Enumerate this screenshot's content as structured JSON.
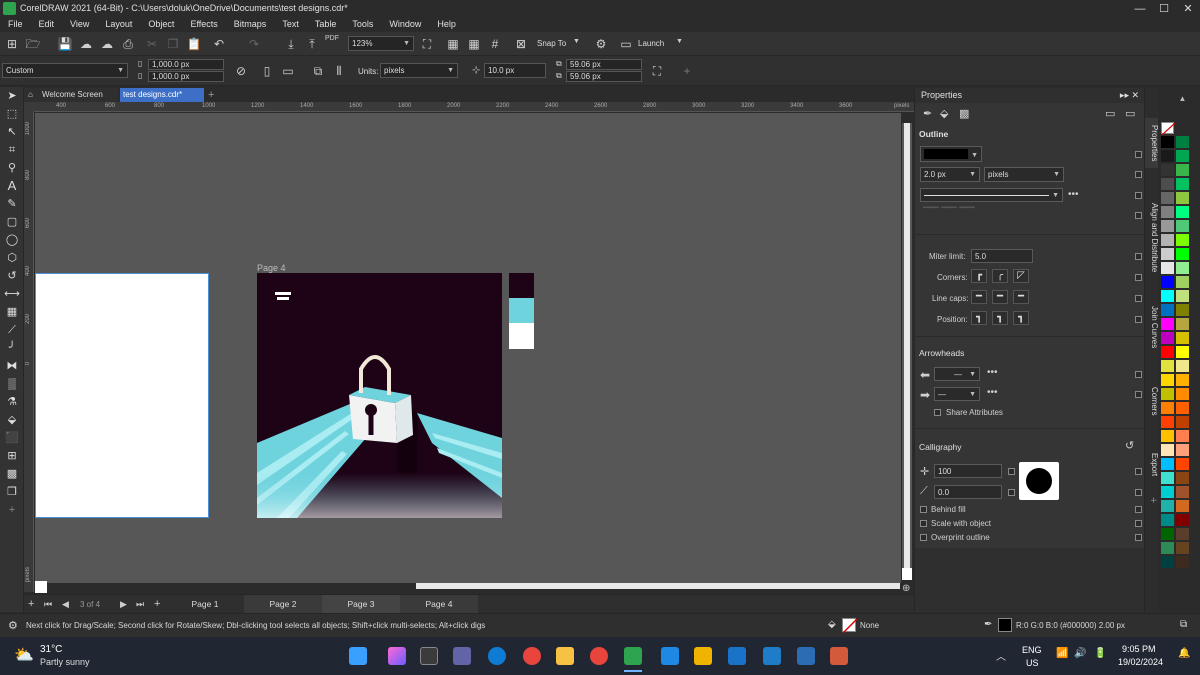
{
  "app": {
    "title": "CorelDRAW 2021 (64-Bit) - C:\\Users\\doluk\\OneDrive\\Documents\\test designs.cdr*"
  },
  "window_controls": {
    "minimize": "—",
    "maximize": "☐",
    "close": "✕"
  },
  "menu": [
    "File",
    "Edit",
    "View",
    "Layout",
    "Object",
    "Effects",
    "Bitmaps",
    "Text",
    "Table",
    "Tools",
    "Window",
    "Help"
  ],
  "toolbar": {
    "pdf_label": "PDF",
    "zoom_value": "123%",
    "snap_to": "Snap To",
    "launch": "Launch"
  },
  "property_bar": {
    "page_preset": "Custom",
    "width": "1,000.0 px",
    "height": "1,000.0 px",
    "units_label": "Units:",
    "units_value": "pixels",
    "nudge": "10.0 px",
    "dup_x": "59.06 px",
    "dup_y": "59.06 px"
  },
  "doc_tabs": [
    {
      "label": "Welcome Screen",
      "active": false
    },
    {
      "label": "test designs.cdr*",
      "active": true
    }
  ],
  "ruler": {
    "h_ticks": [
      "400",
      "600",
      "800",
      "1000",
      "1200",
      "1400",
      "1600",
      "1800",
      "2000",
      "2200",
      "2400",
      "2600",
      "2800",
      "3000",
      "3200",
      "3400",
      "3600"
    ],
    "h_unit": "pixels",
    "v_ticks": [
      "1000",
      "800",
      "600",
      "400",
      "200",
      "0"
    ],
    "v_unit": "pixels"
  },
  "canvas": {
    "page4_label": "Page 4",
    "swatch_colors": [
      "#1e0215",
      "#6fd3de",
      "#ffffff"
    ],
    "artwork_colors": {
      "background": "#1e0215",
      "cyan": "#6fd3de",
      "white": "#ffffff",
      "shackle": "#f2e8d8"
    }
  },
  "page_nav": {
    "counter": "3 of 4",
    "pages": [
      "Page 1",
      "Page 2",
      "Page 3",
      "Page 4"
    ]
  },
  "properties": {
    "title": "Properties",
    "outline": {
      "section": "Outline",
      "width": "2.0 px",
      "units": "pixels",
      "miter_label": "Miter limit:",
      "miter_value": "5.0",
      "corners_label": "Corners:",
      "line_caps_label": "Line caps:",
      "position_label": "Position:"
    },
    "arrowheads": {
      "section": "Arrowheads",
      "share": "Share Attributes"
    },
    "calligraphy": {
      "section": "Calligraphy",
      "stretch": "100",
      "angle": "0.0",
      "behind_fill": "Behind fill",
      "scale_with_object": "Scale with object",
      "overprint": "Overprint outline"
    }
  },
  "dock_tabs": [
    "Properties",
    "Align and Distribute",
    "Join Curves",
    "Corners",
    "Export"
  ],
  "palette_colors": [
    [
      "#ffffff",
      "#ffffff"
    ],
    [
      "#000000",
      "#008040"
    ],
    [
      "#1a1a1a",
      "#00a651"
    ],
    [
      "#333333",
      "#39b54a"
    ],
    [
      "#4d4d4d",
      "#00c060"
    ],
    [
      "#666666",
      "#8dc63f"
    ],
    [
      "#808080",
      "#00ff80"
    ],
    [
      "#999999",
      "#50c878"
    ],
    [
      "#b3b3b3",
      "#7cfc00"
    ],
    [
      "#cccccc",
      "#00ff00"
    ],
    [
      "#e6e6e6",
      "#90ee90"
    ],
    [
      "#0000ff",
      "#a0d060"
    ],
    [
      "#00ffff",
      "#c0e080"
    ],
    [
      "#0070c0",
      "#808000"
    ],
    [
      "#ff00ff",
      "#b5a642"
    ],
    [
      "#c000c0",
      "#d4c000"
    ],
    [
      "#ff0000",
      "#ffff00"
    ],
    [
      "#e0e040",
      "#f0e68c"
    ],
    [
      "#ffd700",
      "#ffb000"
    ],
    [
      "#c0c000",
      "#ff8c00"
    ],
    [
      "#ff8000",
      "#ff6000"
    ],
    [
      "#ff4000",
      "#c04000"
    ],
    [
      "#ffc000",
      "#ff7f50"
    ],
    [
      "#ffe4b5",
      "#ffa07a"
    ],
    [
      "#00bfff",
      "#ff4500"
    ],
    [
      "#40e0d0",
      "#8b4513"
    ],
    [
      "#00ced1",
      "#a0522d"
    ],
    [
      "#20b2aa",
      "#d2691e"
    ],
    [
      "#008b8b",
      "#800000"
    ],
    [
      "#006400",
      "#5a3d2b"
    ],
    [
      "#2e8b57",
      "#654321"
    ],
    [
      "#004040",
      "#3d2b1f"
    ]
  ],
  "status": {
    "hint": "Next click for Drag/Scale; Second click for Rotate/Skew; Dbl-clicking tool selects all objects; Shift+click multi-selects; Alt+click digs",
    "fill_none": "None",
    "outline_info": "R:0 G:0 B:0 (#000000)  2.00 px"
  },
  "taskbar": {
    "temp": "31°C",
    "weather": "Partly sunny",
    "lang_top": "ENG",
    "lang_bottom": "US",
    "time": "9:05 PM",
    "date": "19/02/2024"
  }
}
